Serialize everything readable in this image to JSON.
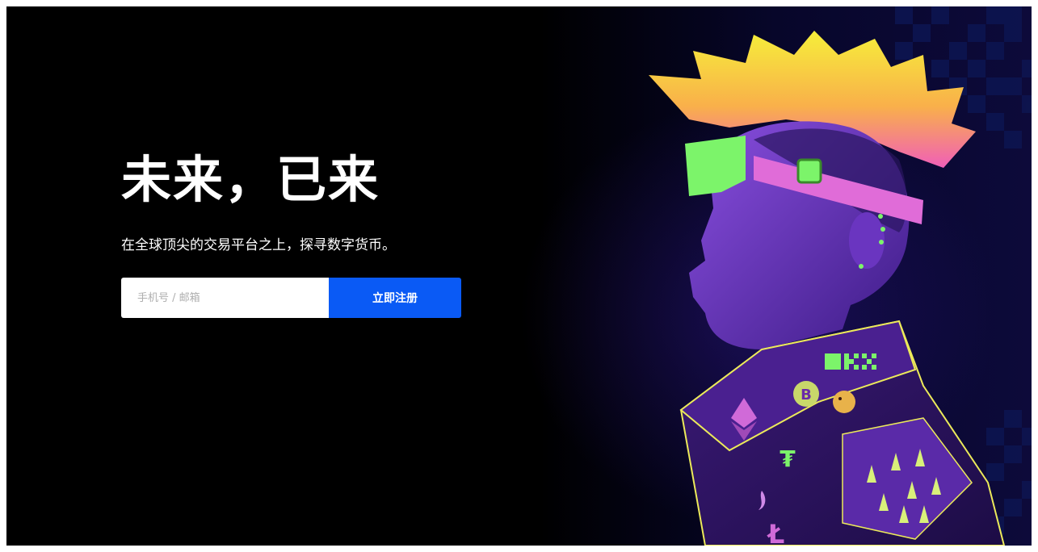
{
  "hero": {
    "headline": "未来，已来",
    "subtitle": "在全球顶尖的交易平台之上，探寻数字货币。"
  },
  "signup": {
    "input_placeholder": "手机号 / 邮箱",
    "button_label": "立即注册"
  },
  "illustration": {
    "jacket_logo_text": "OKX",
    "icons": [
      "ethereum-icon",
      "bitcoin-icon",
      "dogecoin-icon",
      "tether-icon",
      "litecoin-icon",
      "uniswap-icon"
    ]
  },
  "colors": {
    "background": "#000000",
    "button": "#0a5af5",
    "input": "#ffffff",
    "text": "#ffffff"
  }
}
